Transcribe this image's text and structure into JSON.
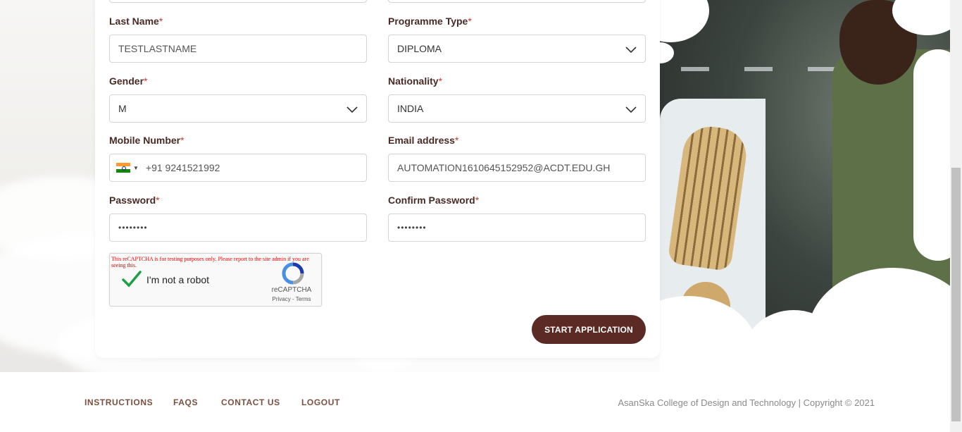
{
  "form": {
    "last_name": {
      "label": "Last Name",
      "required": "*",
      "value": "TESTLASTNAME"
    },
    "programme_type": {
      "label": "Programme Type",
      "required": "*",
      "value": "DIPLOMA"
    },
    "gender": {
      "label": "Gender",
      "required": "*",
      "value": "M"
    },
    "nationality": {
      "label": "Nationality",
      "required": "*",
      "value": "INDIA"
    },
    "mobile": {
      "label": "Mobile Number",
      "required": "*",
      "value": "+91 9241521992",
      "flag_icon": "india-flag-icon"
    },
    "email": {
      "label": "Email address",
      "required": "*",
      "value": "AUTOMATION1610645152952@ACDT.EDU.GH"
    },
    "password": {
      "label": "Password",
      "required": "*",
      "value": "••••••••"
    },
    "confirm_password": {
      "label": "Confirm Password",
      "required": "*",
      "value": "••••••••"
    },
    "captcha": {
      "warning": "This reCAPTCHA is for testing purposes only. Please report to the site admin if you are seeing this.",
      "label": "I'm not a robot",
      "brand": "reCAPTCHA",
      "links": "Privacy - Terms",
      "checked": true
    },
    "submit_label": "START APPLICATION"
  },
  "footer": {
    "links": [
      "INSTRUCTIONS",
      "FAQS",
      "CONTACT US",
      "LOGOUT"
    ],
    "copyright": "AsanSka College of Design and Technology | Copyright © 2021"
  },
  "colors": {
    "brand": "#5b2a24",
    "label": "#4a2a24",
    "required": "#c43b2f",
    "footer_link": "#7a5040"
  }
}
